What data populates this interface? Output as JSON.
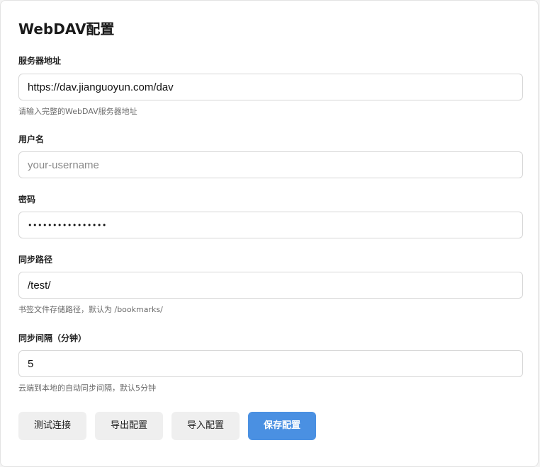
{
  "page": {
    "title": "WebDAV配置"
  },
  "server": {
    "label": "服务器地址",
    "value": "https://dav.jianguoyun.com/dav",
    "placeholder": "",
    "hint": "请输入完整的WebDAV服务器地址"
  },
  "username": {
    "label": "用户名",
    "value": "",
    "placeholder": "your-username"
  },
  "password": {
    "label": "密码",
    "value": "••••••••••••••••"
  },
  "sync_path": {
    "label": "同步路径",
    "value": "/test/",
    "hint": "书签文件存储路径，默认为 /bookmarks/"
  },
  "sync_interval": {
    "label": "同步间隔（分钟）",
    "value": "5",
    "hint": "云端到本地的自动同步间隔，默认5分钟"
  },
  "actions": {
    "test_label": "测试连接",
    "export_label": "导出配置",
    "import_label": "导入配置",
    "save_label": "保存配置"
  },
  "colors": {
    "primary": "#4a90e2",
    "secondary": "#efefef"
  }
}
